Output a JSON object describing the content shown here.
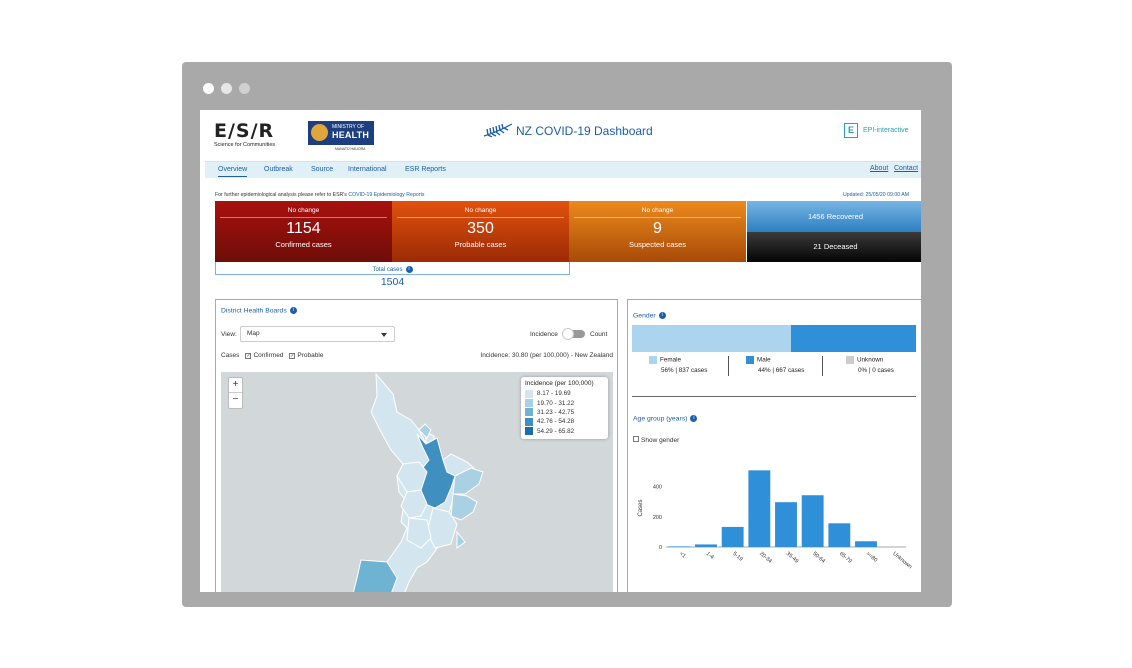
{
  "header": {
    "esr_logo": "E/S/R",
    "esr_tagline": "Science for Communities",
    "moh_small": "MINISTRY OF",
    "moh_big": "HEALTH",
    "moh_maori": "MANATŪ HAUORA",
    "title": "NZ COVID-19 Dashboard",
    "epi_box": "E",
    "epi_text": "EPI-interactive"
  },
  "nav": {
    "tabs": [
      "Overview",
      "Outbreak",
      "Source",
      "International",
      "ESR Reports"
    ],
    "about": "About",
    "contact": "Contact"
  },
  "note": {
    "prefix": "For further epidemiological analysis please refer to ESR's",
    "link": "COVID-19 Epidemiology Reports",
    "updated": "Updated: 25/05/20 09:00 AM"
  },
  "tiles": [
    {
      "change": "No change",
      "value": "1154",
      "label": "Confirmed cases",
      "color": "#a8110e"
    },
    {
      "change": "No change",
      "value": "350",
      "label": "Probable cases",
      "color": "#d4480b"
    },
    {
      "change": "No change",
      "value": "9",
      "label": "Suspected cases",
      "color": "#e07b16"
    }
  ],
  "recovered": "1456 Recovered",
  "deceased": "21 Deceased",
  "total": {
    "label": "Total cases",
    "value": "1504"
  },
  "dhb": {
    "title": "District Health Boards",
    "view_label": "View:",
    "view_value": "Map",
    "toggle_left": "Incidence",
    "toggle_right": "Count",
    "cases_label": "Cases",
    "confirmed": "Confirmed",
    "probable": "Probable",
    "incidence_text": "Incidence: 30.80 (per 100,000) - New Zealand",
    "zoom_in": "+",
    "zoom_out": "−",
    "legend_title": "Incidence (per 100,000)",
    "legend": [
      {
        "label": "8.17 - 19.69",
        "color": "#d3e6ef"
      },
      {
        "label": "19.70 - 31.22",
        "color": "#a9d0e3"
      },
      {
        "label": "31.23 - 42.75",
        "color": "#6fb3d3"
      },
      {
        "label": "42.76 - 54.28",
        "color": "#3f8fc0"
      },
      {
        "label": "54.29 - 65.82",
        "color": "#1f6ca6"
      }
    ]
  },
  "gender": {
    "title": "Gender",
    "female_label": "Female",
    "female_stat": "56% | 837 cases",
    "female_pct": 56,
    "female_color": "#add4ef",
    "male_label": "Male",
    "male_stat": "44% | 667 cases",
    "male_pct": 44,
    "male_color": "#2f8fd8",
    "unknown_label": "Unknown",
    "unknown_stat": "0% | 0 cases",
    "unknown_color": "#cccccc"
  },
  "age": {
    "title": "Age group (years)",
    "show_gender": "Show gender"
  },
  "chart_data": {
    "type": "bar",
    "categories": [
      "<1",
      "1-4",
      "5-19",
      "20-34",
      "35-49",
      "50-64",
      "65-79",
      ">=80",
      "Unknown"
    ],
    "values": [
      4,
      17,
      133,
      508,
      297,
      343,
      157,
      38,
      0
    ],
    "ylabel": "Cases",
    "yticks": [
      0,
      200,
      400
    ],
    "ylim": [
      0,
      550
    ],
    "color": "#2f8fd8"
  }
}
